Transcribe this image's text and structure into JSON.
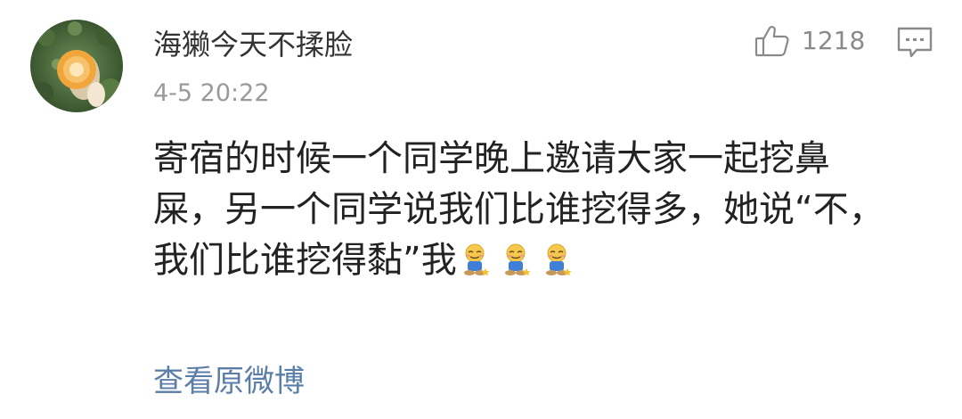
{
  "comment": {
    "author": "海獭今天不揉脸",
    "timestamp": "4-5 20:22",
    "like_count": "1218",
    "body_lines": [
      "寄宿的时候一个同学晚上邀请大家一起挖鼻",
      "屎，另一个同学说我们比谁挖得多，她说“不，",
      "我们比谁挖得黏”我"
    ],
    "emojis": [
      "doge-sitting-emoji",
      "doge-sitting-emoji",
      "doge-sitting-emoji"
    ],
    "view_original_label": "查看原微博"
  },
  "icons": {
    "like": "thumbs-up-icon",
    "reply": "comment-bubble-icon",
    "avatar": "user-avatar"
  },
  "colors": {
    "username": "#333333",
    "timestamp": "#9a9a9a",
    "body": "#222222",
    "link": "#5a7ea8",
    "icon": "#8a8a8a"
  }
}
